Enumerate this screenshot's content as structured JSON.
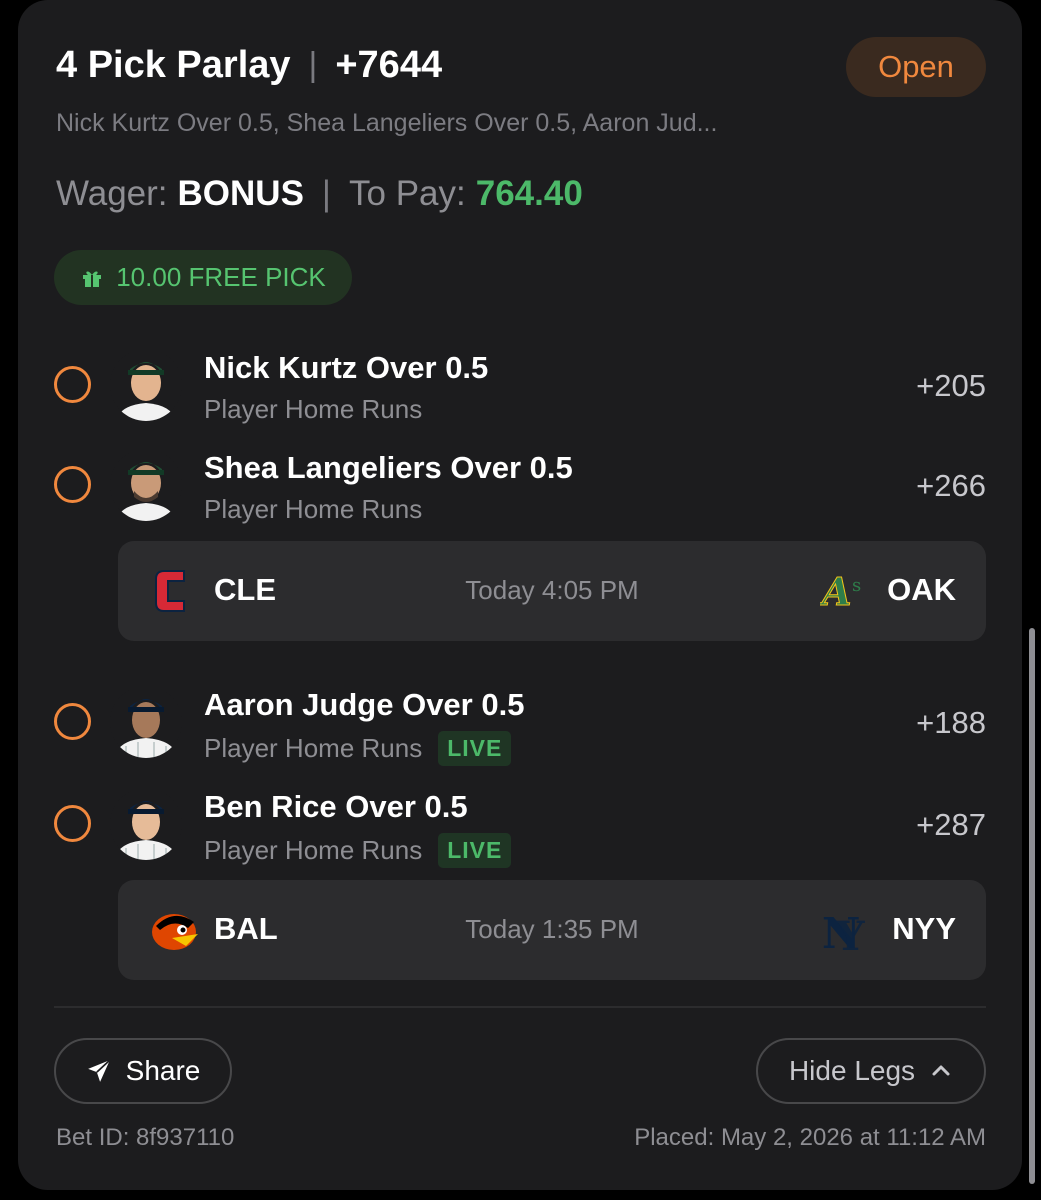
{
  "bet": {
    "title": "4 Pick Parlay",
    "odds": "+7644",
    "status": "Open",
    "summary": "Nick Kurtz Over 0.5, Shea Langeliers Over 0.5, Aaron Jud...",
    "wager_label": "Wager:",
    "wager_value": "BONUS",
    "to_pay_label": "To Pay:",
    "to_pay_value": "764.40",
    "free_pick": "10.00 FREE PICK"
  },
  "legs": [
    {
      "name": "Nick Kurtz Over 0.5",
      "market": "Player Home Runs",
      "odds": "+205",
      "live": ""
    },
    {
      "name": "Shea Langeliers Over 0.5",
      "market": "Player Home Runs",
      "odds": "+266",
      "live": ""
    },
    {
      "name": "Aaron Judge Over 0.5",
      "market": "Player Home Runs",
      "odds": "+188",
      "live": "LIVE"
    },
    {
      "name": "Ben Rice Over 0.5",
      "market": "Player Home Runs",
      "odds": "+287",
      "live": "LIVE"
    }
  ],
  "games": [
    {
      "away": "CLE",
      "time": "Today 4:05 PM",
      "home": "OAK"
    },
    {
      "away": "BAL",
      "time": "Today 1:35 PM",
      "home": "NYY"
    }
  ],
  "actions": {
    "share": "Share",
    "hide_legs": "Hide Legs"
  },
  "footer": {
    "bet_id": "Bet ID: 8f937110",
    "placed": "Placed: May 2, 2026 at 11:12 AM"
  },
  "colors": {
    "accent_orange": "#f0883e",
    "green": "#4cb969",
    "card": "#1c1c1e"
  },
  "icons": [
    "gift-icon",
    "paper-plane-icon",
    "chevron-up-icon",
    "guardians-logo-icon",
    "athletics-logo-icon",
    "orioles-logo-icon",
    "yankees-logo-icon"
  ]
}
